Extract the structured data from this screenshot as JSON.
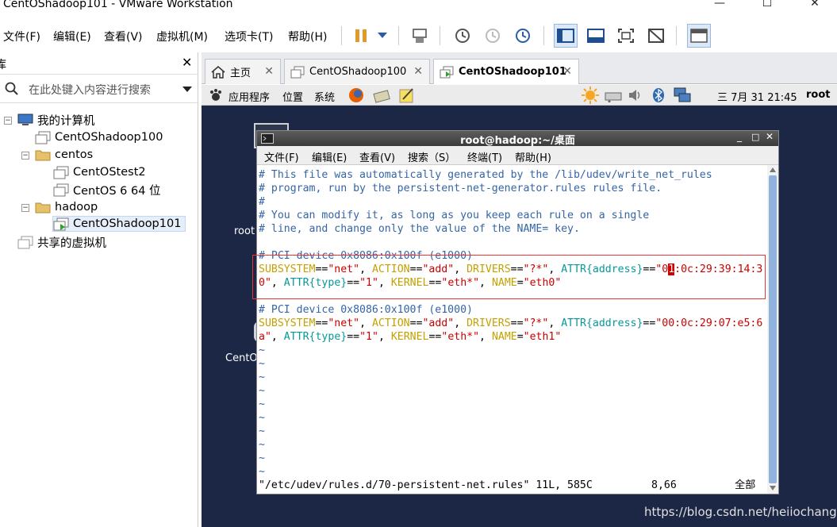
{
  "window": {
    "title": "CentOShadoop101 - VMware Workstation"
  },
  "menu": [
    "文件(F)",
    "编辑(E)",
    "查看(V)",
    "虚拟机(M)",
    "选项卡(T)",
    "帮助(H)"
  ],
  "library": {
    "title": "库",
    "search_placeholder": "在此处键入内容进行搜索",
    "items": [
      "我的计算机",
      "CentOShadoop100",
      "centos",
      "CentOStest2",
      "CentOS 6 64 位",
      "hadoop",
      "CentOShadoop101",
      "共享的虚拟机"
    ]
  },
  "tabs": [
    "主页",
    "CentOShadoop100",
    "CentOShadoop101"
  ],
  "gnome": {
    "apps": "应用程序",
    "places": "位置",
    "system": "系统",
    "clock": "三 7月 31 21:45",
    "user": "root"
  },
  "desktop": {
    "label1": "root",
    "label2": "CentO"
  },
  "terminal": {
    "title": "root@hadoop:~/桌面",
    "menu": [
      "文件(F)",
      "编辑(E)",
      "查看(V)",
      "搜索（S）",
      "终端(T)",
      "帮助(H)"
    ],
    "comment1": "# This file was automatically generated by the /lib/udev/write_net_rules",
    "comment2": "# program, run by the persistent-net-generator.rules rules file.",
    "comment3": "#",
    "comment4": "# You can modify it, as long as you keep each rule on a single",
    "comment5": "# line, and change only the value of the NAME= key.",
    "pci1": "# PCI device 0x8086:0x100f (e1000)",
    "pci2": "# PCI device 0x8086:0x100f (e1000)",
    "rule1": {
      "mac_a": "0",
      "cursor": "1",
      "mac_b": ":0c:29:39:14:3",
      "mac_c": "0",
      "type": "1",
      "kernel": "eth*",
      "name": "eth0"
    },
    "rule2": {
      "mac_a": "00:0c:29:07:e5:6",
      "mac_c": "a",
      "type": "1",
      "kernel": "eth*",
      "name": "eth1"
    },
    "status_file": "\"/etc/udev/rules.d/70-persistent-net.rules\" 11L, 585C",
    "status_pos": "8,66",
    "status_all": "全部"
  },
  "watermark": "https://blog.csdn.net/heiiochange"
}
